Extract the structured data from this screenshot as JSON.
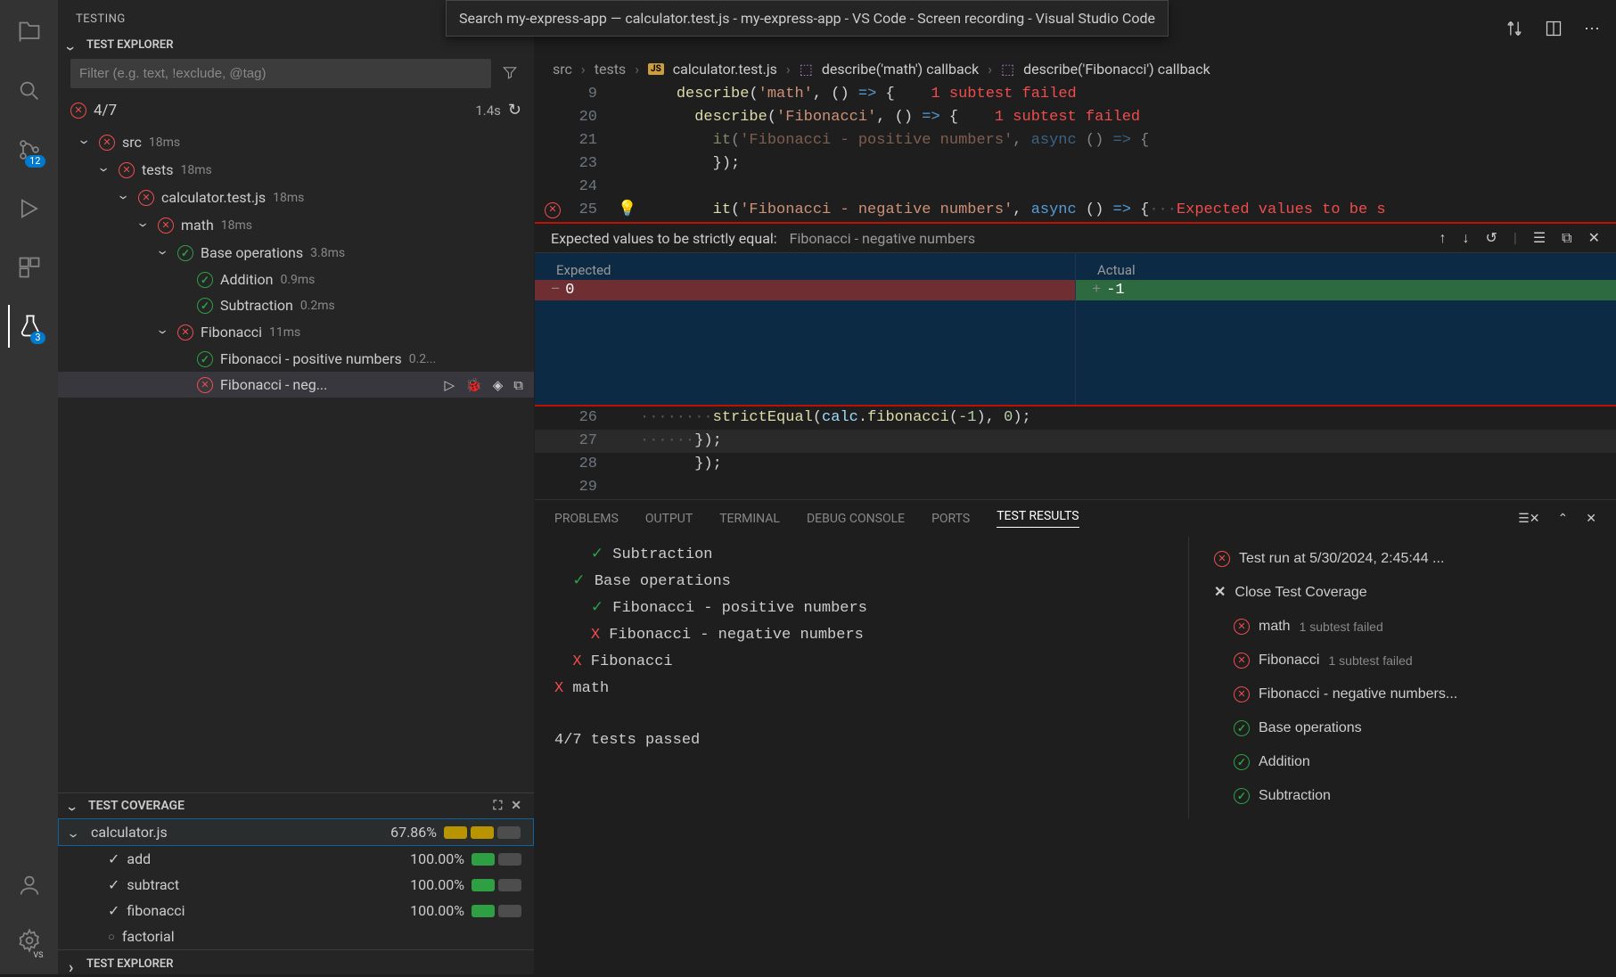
{
  "window_tooltip": "Search my-express-app — calculator.test.js - my-express-app - VS Code - Screen recording - Visual Studio Code",
  "activity_badges": {
    "scm": "12",
    "testing": "3"
  },
  "sidebar": {
    "title": "TESTING",
    "explorer_header": "TEST EXPLORER",
    "filter_placeholder": "Filter (e.g. text, !exclude, @tag)",
    "summary_count": "4/7",
    "summary_time": "1.4s",
    "coverage_header": "TEST COVERAGE",
    "bottom_explorer": "TEST EXPLORER"
  },
  "tree": [
    {
      "depth": 0,
      "status": "fail",
      "label": "src",
      "dur": "18ms"
    },
    {
      "depth": 1,
      "status": "fail",
      "label": "tests",
      "dur": "18ms"
    },
    {
      "depth": 2,
      "status": "fail",
      "label": "calculator.test.js",
      "dur": "18ms"
    },
    {
      "depth": 3,
      "status": "fail",
      "label": "math",
      "dur": "18ms"
    },
    {
      "depth": 4,
      "status": "pass",
      "label": "Base operations",
      "dur": "3.8ms"
    },
    {
      "depth": 5,
      "status": "pass",
      "label": "Addition",
      "dur": "0.9ms",
      "leaf": true
    },
    {
      "depth": 5,
      "status": "pass",
      "label": "Subtraction",
      "dur": "0.2ms",
      "leaf": true
    },
    {
      "depth": 4,
      "status": "fail",
      "label": "Fibonacci",
      "dur": "11ms"
    },
    {
      "depth": 5,
      "status": "pass",
      "label": "Fibonacci - positive numbers",
      "dur": "0.2...",
      "leaf": true
    },
    {
      "depth": 5,
      "status": "fail",
      "label": "Fibonacci - neg...",
      "dur": "",
      "leaf": true,
      "selected": true
    }
  ],
  "coverage": {
    "file": "calculator.js",
    "file_pct": "67.86%",
    "fns": [
      {
        "name": "add",
        "pct": "100.00%"
      },
      {
        "name": "subtract",
        "pct": "100.00%"
      },
      {
        "name": "fibonacci",
        "pct": "100.00%"
      },
      {
        "name": "factorial",
        "pct": "",
        "uncovered": true
      }
    ]
  },
  "breadcrumb": {
    "parts": [
      "src",
      "tests"
    ],
    "file": "calculator.test.js",
    "symbols": [
      "describe('math') callback",
      "describe('Fibonacci') callback"
    ]
  },
  "code_lines": [
    {
      "n": "9",
      "html": "<span class='k-yellow'>describe</span><span class='k-punc'>(</span><span class='k-str'>'math'</span><span class='k-punc'>, () </span><span class='k-blue'>=&gt;</span><span class='k-punc'> {</span>    <span class='code-inline-err'>1 subtest failed</span>",
      "indent": 4
    },
    {
      "n": "20",
      "html": "<span class='k-yellow'>describe</span><span class='k-punc'>(</span><span class='k-str'>'Fibonacci'</span><span class='k-punc'>, () </span><span class='k-blue'>=&gt;</span><span class='k-punc'> {</span>    <span class='code-inline-err'>1 subtest failed</span>",
      "indent": 6
    },
    {
      "n": "21",
      "html": "<span class='k-yellow'>it</span><span class='k-punc'>(</span><span class='k-str'>'Fibonacci - positive numbers'</span><span class='k-punc'>, </span><span class='k-blue'>async</span><span class='k-punc'> () </span><span class='k-blue'>=&gt;</span><span class='k-punc'> {</span>",
      "indent": 8,
      "dim": true
    },
    {
      "n": "23",
      "html": "<span class='k-punc'>});</span>",
      "indent": 8
    },
    {
      "n": "24",
      "html": "",
      "indent": 0
    },
    {
      "n": "25",
      "html": "<span class='k-yellow'>it</span><span class='k-punc'>(</span><span class='k-str'>'Fibonacci - negative numbers'</span><span class='k-punc'>, </span><span class='k-blue'>async</span><span class='k-punc'> () </span><span class='k-blue'>=&gt;</span><span class='k-punc'> {</span><span class='k-punc' style='color:#555'>···</span><span class='code-inline-err'>Expected values to be s</span>",
      "indent": 8,
      "err": true
    }
  ],
  "diff": {
    "title": "Expected values to be strictly equal:",
    "name": "Fibonacci - negative numbers",
    "expected_label": "Expected",
    "actual_label": "Actual",
    "expected": "0",
    "actual": "-1"
  },
  "code_lines_after": [
    {
      "n": "26",
      "html": "<span class='k-punc' style='color:#555'>········</span><span class='k-yellow'>strictEqual</span><span class='k-punc'>(</span><span class='k-var'>calc</span><span class='k-punc'>.</span><span class='k-yellow'>fibonacci</span><span class='k-punc'>(</span><span class='k-num'>-1</span><span class='k-punc'>), </span><span class='k-num'>0</span><span class='k-punc'>);</span>",
      "indent": 0
    },
    {
      "n": "27",
      "html": "<span class='k-punc' style='color:#555'>······</span><span class='k-punc'>});</span>",
      "indent": 0,
      "hl": true
    },
    {
      "n": "28",
      "html": "<span class='k-punc'>});</span>",
      "indent": 6
    },
    {
      "n": "29",
      "html": "",
      "indent": 0
    }
  ],
  "panel": {
    "tabs": [
      "PROBLEMS",
      "OUTPUT",
      "TERMINAL",
      "DEBUG CONSOLE",
      "PORTS",
      "TEST RESULTS"
    ],
    "active": "TEST RESULTS",
    "results_left": [
      {
        "sym": "pass",
        "indent": 2,
        "text": "Subtraction"
      },
      {
        "sym": "pass",
        "indent": 1,
        "text": "Base operations"
      },
      {
        "sym": "pass",
        "indent": 2,
        "text": "Fibonacci - positive numbers"
      },
      {
        "sym": "fail",
        "indent": 2,
        "text": "Fibonacci - negative numbers"
      },
      {
        "sym": "fail",
        "indent": 1,
        "text": "Fibonacci"
      },
      {
        "sym": "fail",
        "indent": 0,
        "text": "math"
      }
    ],
    "summary": "4/7 tests passed",
    "results_right": [
      {
        "status": "fail",
        "label": "Test run at 5/30/2024, 2:45:44 ..."
      },
      {
        "status": "x",
        "label": "Close Test Coverage"
      },
      {
        "status": "fail",
        "label": "math",
        "sub": "1 subtest failed"
      },
      {
        "status": "fail",
        "label": "Fibonacci",
        "sub": "1 subtest failed"
      },
      {
        "status": "fail",
        "label": "Fibonacci - negative numbers..."
      },
      {
        "status": "pass",
        "label": "Base operations"
      },
      {
        "status": "pass",
        "label": "Addition"
      },
      {
        "status": "pass",
        "label": "Subtraction"
      }
    ]
  }
}
